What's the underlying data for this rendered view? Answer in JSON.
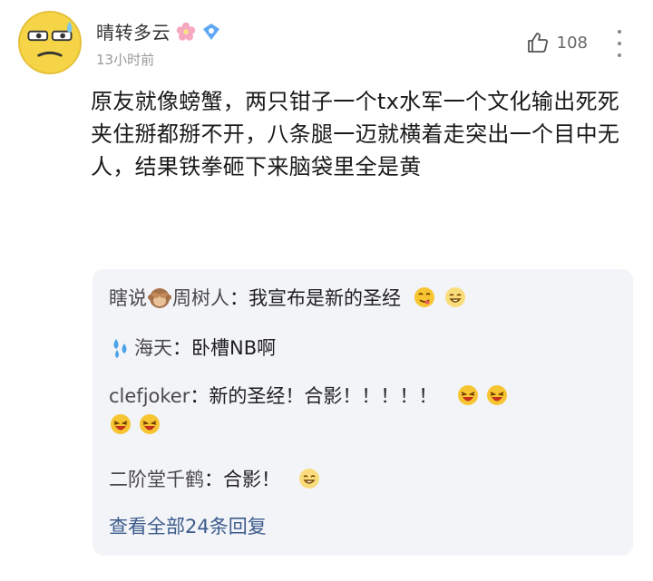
{
  "user": {
    "name": "晴转多云",
    "time": "13小时前",
    "likes": "108"
  },
  "comment": {
    "text": "原友就像螃蟹，两只钳子一个tx水军一个文化输出死死夹住掰都掰不开，八条腿一迈就横着走突出一个目中无人，结果铁拳砸下来脑袋里全是黄"
  },
  "replies": [
    {
      "author": "瞎说",
      "author_suffix": "周树人",
      "sep": "：",
      "text": "我宣布是新的圣经"
    },
    {
      "author": "海天",
      "sep": "：",
      "text": "卧槽NB啊"
    },
    {
      "author": "clefjoker",
      "sep": "：",
      "text": "新的圣经！合影！！！！！"
    },
    {
      "author": "二阶堂千鹤",
      "sep": "：",
      "text": "合影！"
    }
  ],
  "view_all": "查看全部24条回复",
  "colors": {
    "link": "#3b5b8c",
    "reply_bg": "#f3f4f8",
    "meta": "#999999"
  }
}
